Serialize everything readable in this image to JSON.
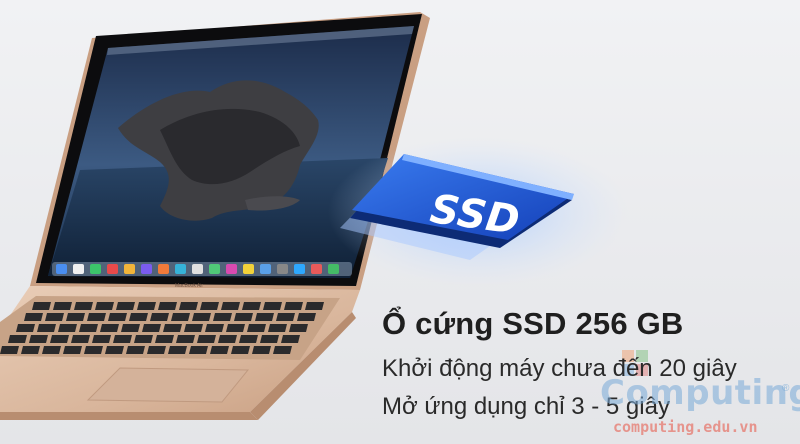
{
  "headline": "Ổ cứng SSD 256 GB",
  "lines": [
    "Khởi động máy chưa đến 20 giây",
    "Mở ứng dụng chỉ 3 - 5 giây"
  ],
  "ssd_label": "SSD",
  "laptop_brand_label": "MacBook Air",
  "watermark": {
    "big": "Computing",
    "small": "computing.edu.vn",
    "reg": "®"
  },
  "colors": {
    "laptop_body": "#d8b9a0",
    "screen_bezel": "#0c0c0e",
    "ssd_blue": "#1f5fd6",
    "watermark_blue": "#78aad7",
    "watermark_red": "#e6786e"
  }
}
